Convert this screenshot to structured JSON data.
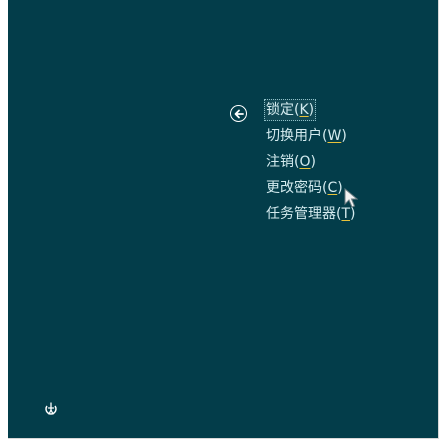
{
  "menu": {
    "items": [
      {
        "label": "锁定(",
        "key": "K",
        "end": ")"
      },
      {
        "label": "切换用户(",
        "key": "W",
        "end": ")"
      },
      {
        "label": "注销(",
        "key": "O",
        "end": ")"
      },
      {
        "label": "更改密码(",
        "key": "C",
        "end": ")"
      },
      {
        "label": "任务管理器(",
        "key": "T",
        "end": ")"
      }
    ]
  },
  "icons": {
    "back": "back-arrow-icon",
    "ease_of_access": "ease-of-access-icon",
    "cursor": "mouse-pointer-icon"
  },
  "colors": {
    "background": "#033d4a",
    "text": "#d4ebef",
    "accelerator_underline": "#e8c23a"
  }
}
